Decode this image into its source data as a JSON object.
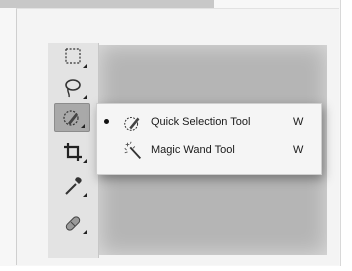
{
  "tools": [
    {
      "name": "rectangular-marquee-icon"
    },
    {
      "name": "lasso-icon"
    },
    {
      "name": "quick-selection-icon",
      "active": true
    },
    {
      "name": "crop-icon"
    },
    {
      "name": "eyedropper-icon"
    },
    {
      "name": "healing-brush-icon"
    }
  ],
  "flyout": {
    "items": [
      {
        "label": "Quick Selection Tool",
        "shortcut": "W",
        "selected": true,
        "icon": "quick-selection-icon"
      },
      {
        "label": "Magic Wand Tool",
        "shortcut": "W",
        "selected": false,
        "icon": "magic-wand-icon"
      }
    ]
  },
  "colors": {
    "toolbar": "#e3e3e3",
    "canvas": "#b5b5b5",
    "flyout": "#f5f5f5",
    "active_tool": "#a9a9a9"
  }
}
